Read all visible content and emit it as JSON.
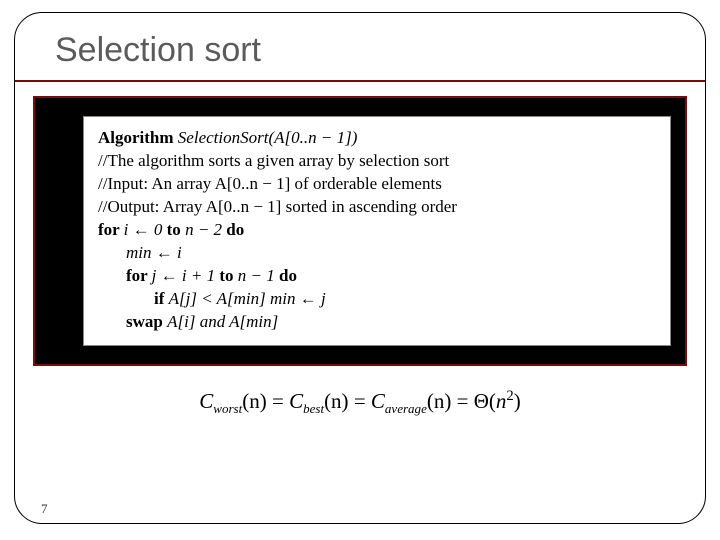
{
  "title": "Selection sort",
  "code": {
    "l1_alg": "Algorithm",
    "l1_sig": " SelectionSort(A[0..n − 1])",
    "l2": "//The algorithm sorts a given array by selection sort",
    "l3": "//Input: An array A[0..n − 1] of orderable elements",
    "l4": "//Output: Array A[0..n − 1] sorted in ascending order",
    "l5_for": "for ",
    "l5_body": "i ← 0 ",
    "l5_to": "to",
    "l5_end": " n − 2 ",
    "l5_do": "do",
    "l6": "min ← i",
    "l7_for": "for ",
    "l7_body": "j ← i + 1 ",
    "l7_to": "to",
    "l7_end": " n − 1 ",
    "l7_do": "do",
    "l8_if": "if ",
    "l8_body": " A[j] < A[min]    min ← j",
    "l9_swap": "swap ",
    "l9_body": "A[i] and A[min]"
  },
  "equation": {
    "c": "C",
    "worst": "worst",
    "best": "best",
    "average": "average",
    "n_arg": "(n)",
    "eq": " = ",
    "theta": "Θ",
    "open": "(",
    "nvar": "n",
    "sq": "2",
    "close": ")"
  },
  "page_number": "7"
}
